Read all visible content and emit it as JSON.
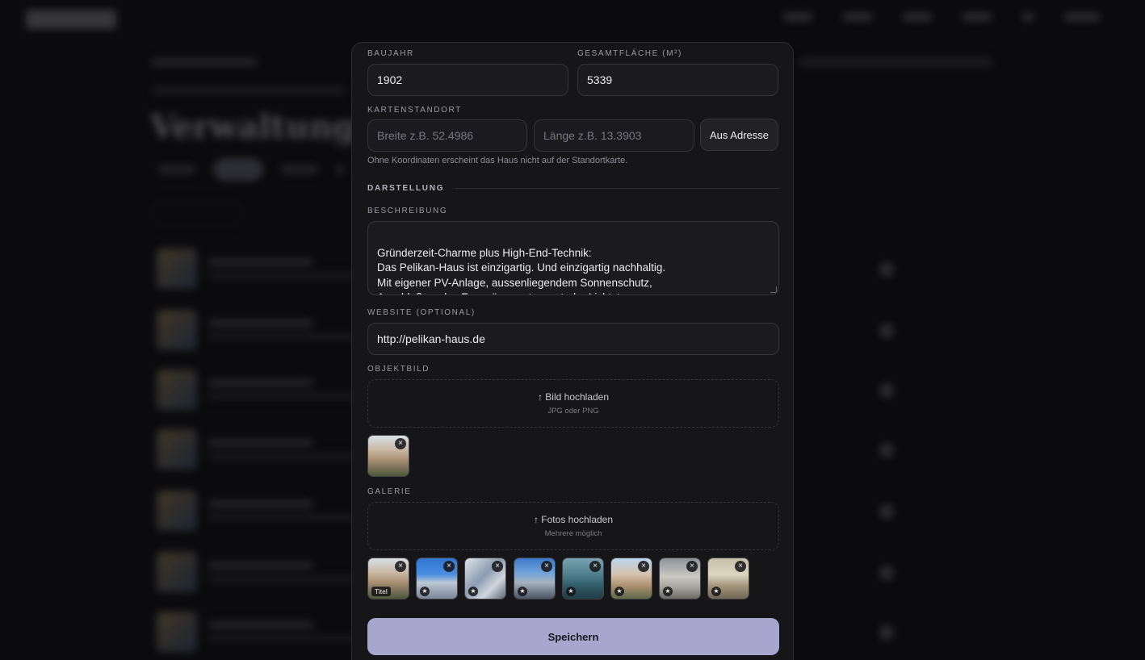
{
  "background": {
    "page_title": "Verwaltung."
  },
  "form": {
    "baujahr": {
      "label": "BAUJAHR",
      "value": "1902"
    },
    "gesamtflaeche": {
      "label": "GESAMTFLÄCHE (M²)",
      "value": "5339"
    },
    "kartenstandort": {
      "label": "KARTENSTANDORT",
      "breite_placeholder": "Breite  z.B. 52.4986",
      "laenge_placeholder": "Länge  z.B. 13.3903",
      "button": "Aus Adresse",
      "hint": "Ohne Koordinaten erscheint das Haus nicht auf der Standortkarte."
    },
    "section_darstellung": "DARSTELLUNG",
    "beschreibung": {
      "label": "BESCHREIBUNG",
      "value": "Gründerzeit-Charme plus High-End-Technik:\nDas Pelikan-Haus ist einzigartig. Und einzigartig nachhaltig.\nMit eigener PV-Anlage, aussenliegendem Sonnenschutz,\nAnschluß an das Fernwärmenetz, zentraler Lichtsteuerung"
    },
    "website": {
      "label": "WEBSITE (OPTIONAL)",
      "value": "http://pelikan-haus.de"
    },
    "objektbild": {
      "label": "OBJEKTBILD",
      "upload": "↑ Bild hochladen",
      "sub": "JPG oder PNG"
    },
    "galerie": {
      "label": "GALERIE",
      "upload": "↑ Fotos hochladen",
      "sub": "Mehrere möglich",
      "title_badge": "Titel",
      "images": [
        "facade-1",
        "courtyard-sky",
        "glass-facade",
        "corner-building",
        "green-facade",
        "facade-2",
        "courtyard-2",
        "terrace"
      ]
    },
    "save": "Speichern"
  },
  "icons": {
    "remove": "×",
    "star": "★"
  }
}
